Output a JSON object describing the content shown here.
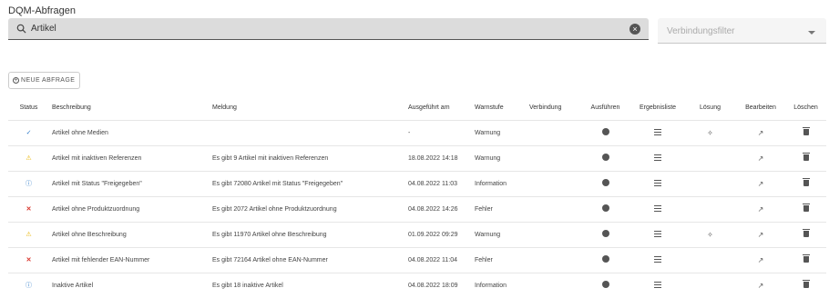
{
  "page": {
    "title": "DQM-Abfragen"
  },
  "search": {
    "value": "Artikel",
    "search_icon": "search-icon",
    "clear_icon": "clear-icon"
  },
  "connection_filter": {
    "placeholder": "Verbindungsfilter",
    "icon": "chevron-down-icon"
  },
  "new_query_button": {
    "label": "NEUE ABFRAGE",
    "icon": "plus-circle-icon"
  },
  "table": {
    "columns": [
      "Status",
      "Beschreibung",
      "Meldung",
      "Ausgeführt am",
      "Warnstufe",
      "Verbindung",
      "Ausführen",
      "Ergebnisliste",
      "Lösung",
      "Bearbeiten",
      "Löschen"
    ],
    "rows": [
      {
        "status": "ok",
        "status_icon": "check-icon",
        "beschreibung": "Artikel ohne Medien",
        "meldung": "",
        "ausgefuehrt": "-",
        "warnstufe": "Warnung",
        "verbindung": "",
        "has_loesung": true
      },
      {
        "status": "warn",
        "status_icon": "warning-icon",
        "beschreibung": "Artikel mit inaktiven Referenzen",
        "meldung": "Es gibt 9 Artikel mit inaktiven Referenzen",
        "ausgefuehrt": "18.08.2022 14:18",
        "warnstufe": "Warnung",
        "verbindung": "",
        "has_loesung": false
      },
      {
        "status": "info",
        "status_icon": "info-icon",
        "beschreibung": "Artikel mit Status \"Freigegeben\"",
        "meldung": "Es gibt 72080 Artikel mit Status \"Freigegeben\"",
        "ausgefuehrt": "04.08.2022 11:03",
        "warnstufe": "Information",
        "verbindung": "",
        "has_loesung": false
      },
      {
        "status": "err",
        "status_icon": "error-x-icon",
        "beschreibung": "Artikel ohne Produktzuordnung",
        "meldung": "Es gibt 2072 Artikel ohne Produktzuordnung",
        "ausgefuehrt": "04.08.2022 14:26",
        "warnstufe": "Fehler",
        "verbindung": "",
        "has_loesung": false
      },
      {
        "status": "warn",
        "status_icon": "warning-icon",
        "beschreibung": "Artikel ohne Beschreibung",
        "meldung": "Es gibt 11970 Artikel ohne Beschreibung",
        "ausgefuehrt": "01.09.2022 09:29",
        "warnstufe": "Warnung",
        "verbindung": "",
        "has_loesung": true
      },
      {
        "status": "err",
        "status_icon": "error-x-icon",
        "beschreibung": "Artikel mit fehlender EAN-Nummer",
        "meldung": "Es gibt 72164 Artikel ohne EAN-Nummer",
        "ausgefuehrt": "04.08.2022 11:04",
        "warnstufe": "Fehler",
        "verbindung": "",
        "has_loesung": false
      },
      {
        "status": "info",
        "status_icon": "info-icon",
        "beschreibung": "Inaktive Artikel",
        "meldung": "Es gibt 18 inaktive Artikel",
        "ausgefuehrt": "04.08.2022 18:09",
        "warnstufe": "Information",
        "verbindung": "",
        "has_loesung": false
      }
    ]
  },
  "icons": {
    "run": "play-circle-icon",
    "result_list": "list-icon",
    "solution": "magic-wand-icon",
    "edit": "edit-icon",
    "delete": "trash-icon"
  }
}
